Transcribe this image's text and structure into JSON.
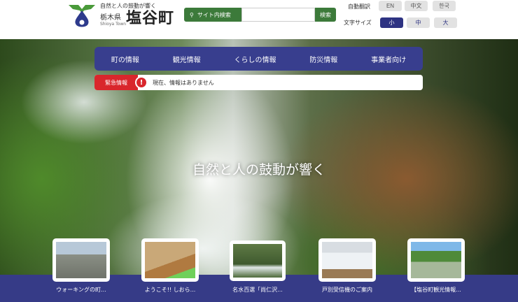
{
  "header": {
    "tagline": "自然と人の鼓動が響く",
    "prefecture": "栃木県",
    "town": "塩谷町",
    "romaji": "Shioya Town",
    "search": {
      "label": "サイト内検索",
      "placeholder": "",
      "button": "検索"
    },
    "translate": {
      "label": "自動翻訳",
      "options": [
        "EN",
        "中文",
        "한국"
      ]
    },
    "font_size": {
      "label": "文字サイズ",
      "options": [
        "小",
        "中",
        "大"
      ],
      "selected": "小"
    }
  },
  "nav": [
    "町の情報",
    "観光情報",
    "くらしの情報",
    "防災情報",
    "事業者向け"
  ],
  "alert": {
    "label": "緊急情報",
    "text": "現在、情報はありません"
  },
  "hero": {
    "tagline": "自然と人の鼓動が響く"
  },
  "cards": [
    {
      "label": "ウォーキングの町..."
    },
    {
      "label": "ようこそ!! しおら..."
    },
    {
      "label": "名水百選「尚仁沢..."
    },
    {
      "label": "戸別受信機のご案内"
    },
    {
      "label": "【塩谷町観光情報..."
    }
  ],
  "colors": {
    "navy": "#383e8e",
    "green": "#3c7a3a",
    "red": "#d9262c"
  }
}
